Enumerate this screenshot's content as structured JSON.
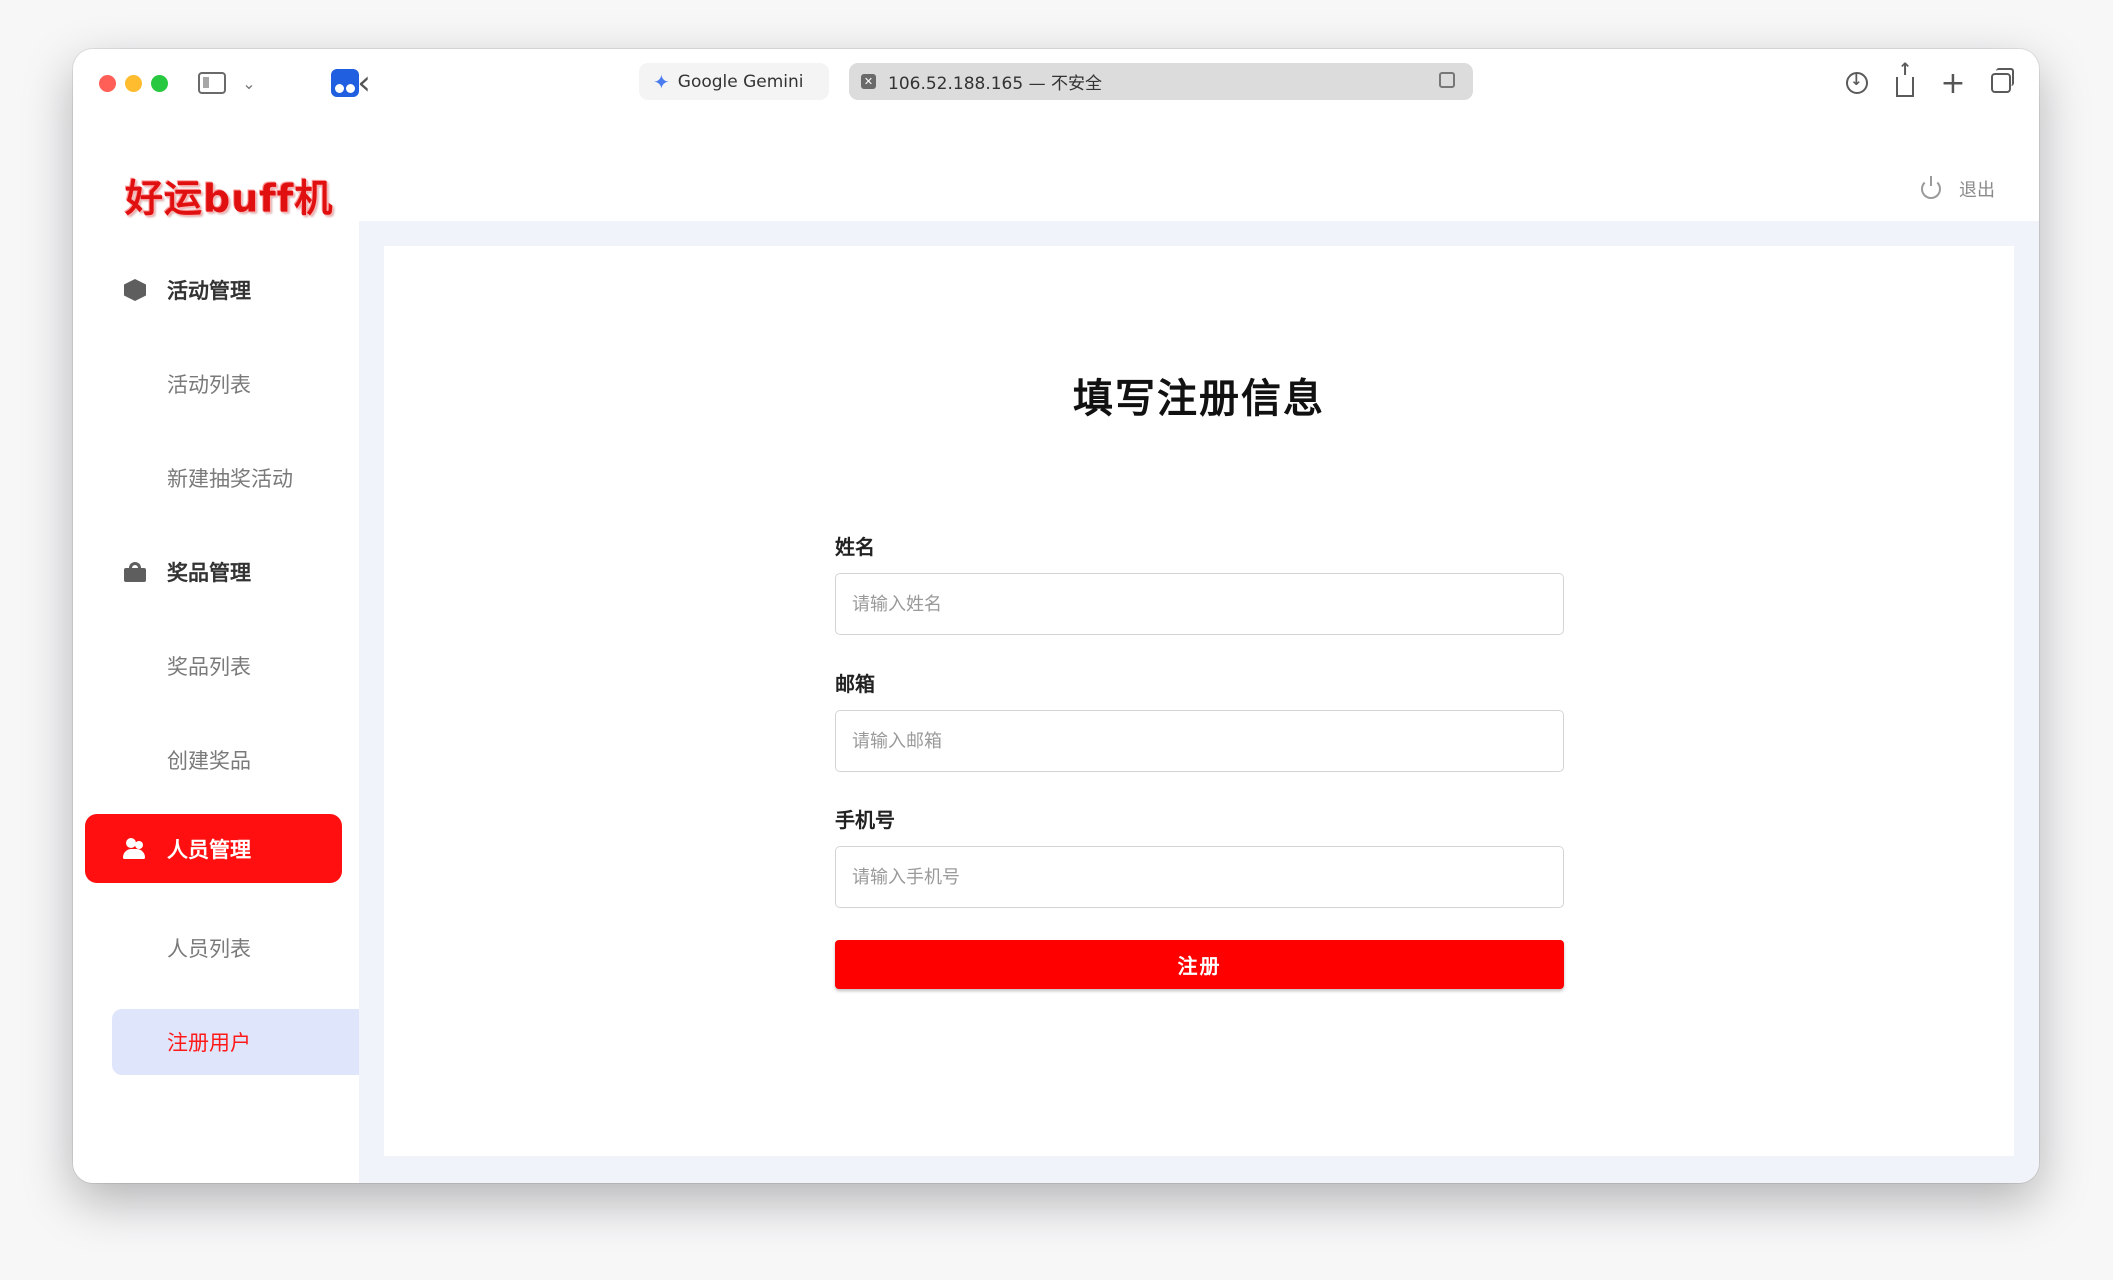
{
  "browser": {
    "tabs": [
      {
        "label": "Google Gemini",
        "icon": "gemini-star-icon"
      },
      {
        "label": "106.52.188.165 — 不安全",
        "icon": "insecure-site-icon"
      }
    ]
  },
  "header": {
    "logo": "好运buff机",
    "logout_label": "退出"
  },
  "sidebar": {
    "groups": [
      {
        "label": "活动管理",
        "icon": "cube-icon",
        "items": [
          "活动列表",
          "新建抽奖活动"
        ]
      },
      {
        "label": "奖品管理",
        "icon": "gift-icon",
        "items": [
          "奖品列表",
          "创建奖品"
        ]
      },
      {
        "label": "人员管理",
        "icon": "users-icon",
        "items": [
          "人员列表",
          "注册用户"
        ]
      }
    ],
    "active_group": "人员管理",
    "selected_item": "注册用户"
  },
  "form": {
    "title": "填写注册信息",
    "fields": [
      {
        "label": "姓名",
        "placeholder": "请输入姓名",
        "value": ""
      },
      {
        "label": "邮箱",
        "placeholder": "请输入邮箱",
        "value": ""
      },
      {
        "label": "手机号",
        "placeholder": "请输入手机号",
        "value": ""
      }
    ],
    "submit_label": "注册"
  },
  "colors": {
    "accent": "#ff0000",
    "selected_bg": "#dfe6fb",
    "content_bg": "#f1f3fb"
  }
}
